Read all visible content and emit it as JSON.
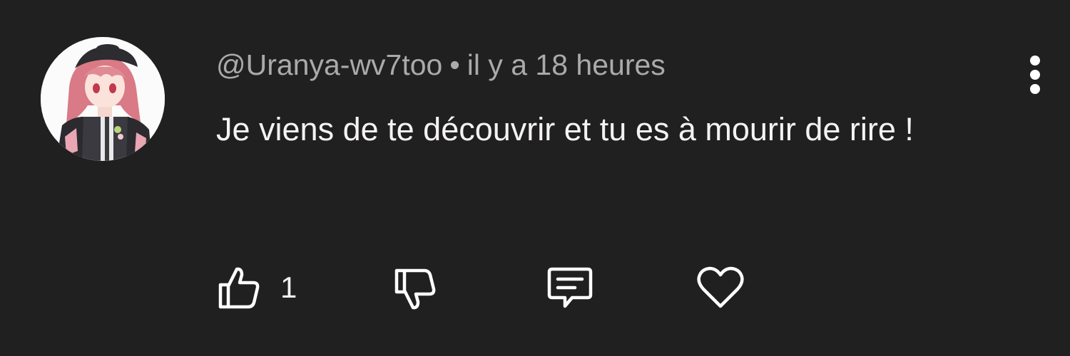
{
  "comment": {
    "author": "@Uranya-wv7too",
    "separator": "•",
    "timestamp": "il y a 18 heures",
    "text": "Je viens de te découvrir et tu es à mourir de rire !",
    "like_count": "1"
  },
  "icons": {
    "more": "more-vertical-icon",
    "like": "thumb-up-icon",
    "dislike": "thumb-down-icon",
    "reply": "comment-reply-icon",
    "heart": "heart-icon"
  },
  "colors": {
    "background": "#212020",
    "meta_text": "#aaaaaa",
    "body_text": "#f4f2f2",
    "icon": "#ffffff"
  }
}
